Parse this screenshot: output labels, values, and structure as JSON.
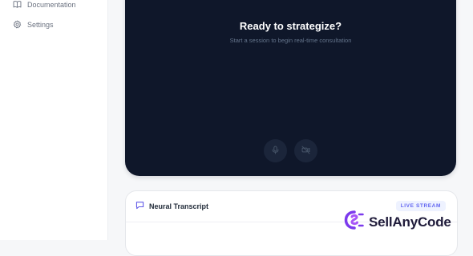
{
  "sidebar": {
    "items": [
      {
        "label": "Documentation",
        "icon": "book-icon"
      },
      {
        "label": "Settings",
        "icon": "gear-icon"
      }
    ]
  },
  "session": {
    "title": "Ready to strategize?",
    "subtitle": "Start a session to begin real-time consultation",
    "controls": [
      {
        "icon": "microphone-icon"
      },
      {
        "icon": "camera-off-icon"
      }
    ]
  },
  "transcript": {
    "title": "Neural Transcript",
    "badge": "LIVE STREAM",
    "icon": "chat-bubble-icon"
  },
  "watermark": {
    "text": "SellAnyCode",
    "icon": "sellanycode-logo-icon"
  },
  "colors": {
    "session_bg": "#0f172a",
    "accent": "#6366f1",
    "watermark_purple": "#7c3aed"
  }
}
